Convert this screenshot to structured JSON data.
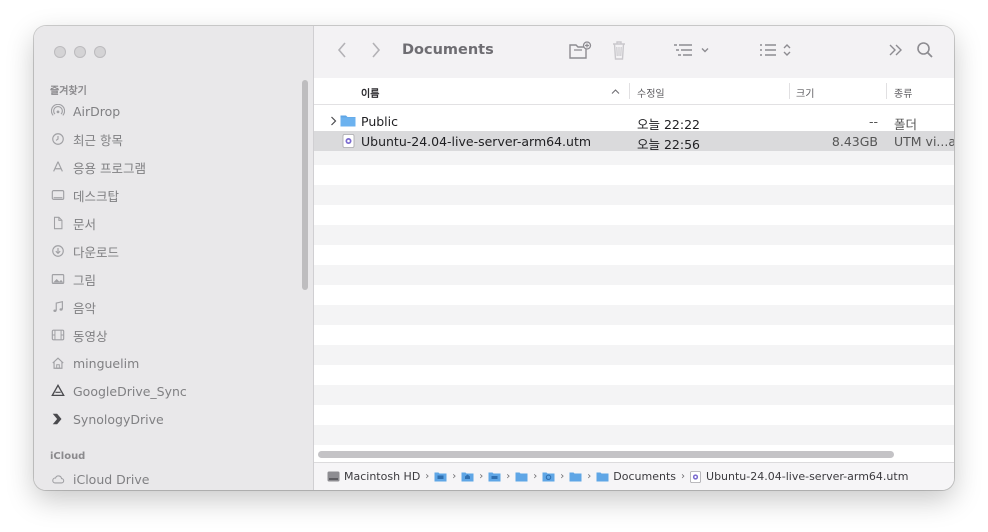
{
  "sidebar": {
    "favorites_header": "즐겨찾기",
    "items": [
      {
        "label": "AirDrop",
        "icon": "airdrop-icon"
      },
      {
        "label": "최근 항목",
        "icon": "clock-icon"
      },
      {
        "label": "응용 프로그램",
        "icon": "applications-icon"
      },
      {
        "label": "데스크탑",
        "icon": "desktop-icon"
      },
      {
        "label": "문서",
        "icon": "document-icon"
      },
      {
        "label": "다운로드",
        "icon": "download-icon"
      },
      {
        "label": "그림",
        "icon": "pictures-icon"
      },
      {
        "label": "음악",
        "icon": "music-icon"
      },
      {
        "label": "동영상",
        "icon": "movies-icon"
      },
      {
        "label": "minguelim",
        "icon": "home-icon"
      },
      {
        "label": "GoogleDrive_Sync",
        "icon": "google-drive-icon"
      },
      {
        "label": "SynologyDrive",
        "icon": "synology-drive-icon"
      }
    ],
    "icloud_header": "iCloud",
    "icloud_items": [
      {
        "label": "iCloud Drive",
        "icon": "cloud-icon"
      }
    ]
  },
  "toolbar": {
    "title": "Documents"
  },
  "columns": {
    "name": "이름",
    "modified": "수정일",
    "size": "크기",
    "kind": "종류"
  },
  "files": [
    {
      "name": "Public",
      "modified": "오늘 22:22",
      "size": "--",
      "kind": "폴더",
      "type": "folder"
    },
    {
      "name": "Ubuntu-24.04-live-server-arm64.utm",
      "modified": "오늘 22:56",
      "size": "8.43GB",
      "kind": "UTM vi...a",
      "type": "utm"
    }
  ],
  "pathbar": {
    "root": "Macintosh HD",
    "documents": "Documents",
    "file": "Ubuntu-24.04-live-server-arm64.utm"
  },
  "colors": {
    "folder": "#5fa6e6",
    "sidebar_bg": "#e9e8ea",
    "selected_row": "#dadadc"
  }
}
